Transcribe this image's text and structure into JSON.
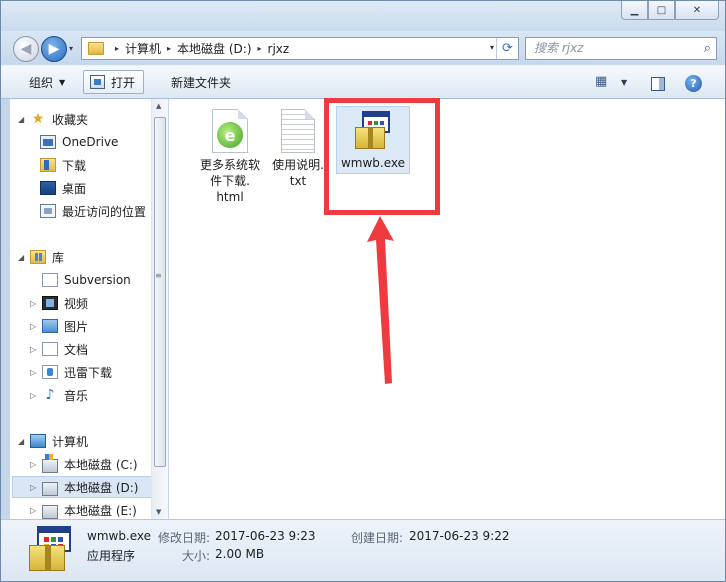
{
  "window": {
    "min_symbol": "▁",
    "max_symbol": "□",
    "close_symbol": "✕"
  },
  "nav": {
    "back_symbol": "◀",
    "forward_symbol": "▶",
    "dropdown_symbol": "▾"
  },
  "address": {
    "crumbs": [
      "计算机",
      "本地磁盘 (D:)",
      "rjxz"
    ],
    "separator": "▸",
    "dropdown_symbol": "▾",
    "refresh_symbol": "⟳"
  },
  "search": {
    "placeholder": "搜索 rjxz",
    "icon": "⌕"
  },
  "toolbar": {
    "organize_label": "组织",
    "organize_arrow": "▼",
    "open_label": "打开",
    "new_folder_label": "新建文件夹",
    "views_arrow": "▼",
    "help_label": "?",
    "views_icon": "▦"
  },
  "sidebar": {
    "groups": [
      {
        "label": "收藏夹",
        "expand": "◢",
        "icon": "star-icon",
        "items": [
          {
            "label": "OneDrive",
            "icon": "onedrive-icon"
          },
          {
            "label": "下载",
            "icon": "downloads-folder-icon"
          },
          {
            "label": "桌面",
            "icon": "desktop-icon"
          },
          {
            "label": "最近访问的位置",
            "icon": "recent-places-icon"
          }
        ]
      },
      {
        "label": "库",
        "expand": "◢",
        "icon": "library-icon",
        "items": [
          {
            "label": "Subversion",
            "icon": "document-icon",
            "expand": ""
          },
          {
            "label": "视频",
            "icon": "video-library-icon",
            "expand": "▷"
          },
          {
            "label": "图片",
            "icon": "pictures-library-icon",
            "expand": "▷"
          },
          {
            "label": "文档",
            "icon": "documents-library-icon",
            "expand": "▷"
          },
          {
            "label": "迅雷下载",
            "icon": "thunder-download-icon",
            "expand": "▷"
          },
          {
            "label": "音乐",
            "icon": "music-library-icon",
            "expand": "▷"
          }
        ]
      },
      {
        "label": "计算机",
        "expand": "◢",
        "icon": "computer-icon",
        "items": [
          {
            "label": "本地磁盘 (C:)",
            "icon": "system-drive-icon",
            "expand": "▷"
          },
          {
            "label": "本地磁盘 (D:)",
            "icon": "drive-icon",
            "expand": "▷",
            "selected": true
          },
          {
            "label": "本地磁盘 (E:)",
            "icon": "drive-icon",
            "expand": "▷"
          }
        ]
      }
    ],
    "scroll_up": "▲",
    "scroll_down": "▼",
    "grip": "≡",
    "music_glyph": "♪",
    "star_glyph": "★"
  },
  "files": [
    {
      "name": "更多系统软件下载.html",
      "lines": [
        "更多系统软",
        "件下载.",
        "html"
      ],
      "type": "html"
    },
    {
      "name": "使用说明.txt",
      "lines": [
        "使用说明.",
        "txt"
      ],
      "type": "txt"
    },
    {
      "name": "wmwb.exe",
      "lines": [
        "wmwb.exe"
      ],
      "type": "exe",
      "selected": true
    }
  ],
  "details": {
    "filename": "wmwb.exe",
    "filetype": "应用程序",
    "modified_label": "修改日期:",
    "modified_value": "2017-06-23 9:23",
    "size_label": "大小:",
    "size_value": "2.00 MB",
    "created_label": "创建日期:",
    "created_value": "2017-06-23 9:22"
  },
  "colors": {
    "annotation_red": "#ef3b3f",
    "selection_blue": "#dbe8f6"
  }
}
